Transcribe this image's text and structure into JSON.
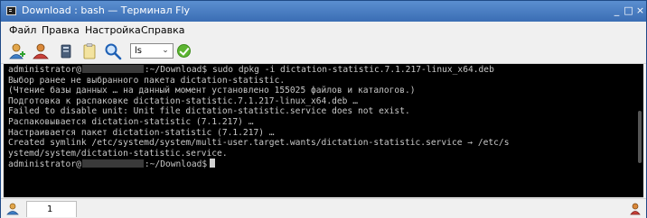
{
  "window": {
    "title": "Download : bash — Терминал Fly",
    "minimize_glyph": "_",
    "maximize_glyph": "□",
    "close_glyph": "×"
  },
  "menu": [
    "Файл",
    "Правка",
    "Настройка",
    "Справка"
  ],
  "toolbar": {
    "combo_value": "ls",
    "combo_chevron": "⌄",
    "icons": [
      "new-session-icon",
      "user-sessions-icon",
      "bookmark-icon",
      "clipboard-icon",
      "search-icon",
      "ok-check-icon"
    ],
    "ok_color": "#5cb531"
  },
  "terminal": {
    "background": "#000000",
    "foreground": "#c8c8c8",
    "lines": [
      {
        "pre": "administrator@",
        "post": ":~/Download$ sudo dpkg -i dictation-statistic.7.1.217-linux_x64.deb"
      },
      {
        "pre": "Выбор ранее не выбранного пакета dictation-statistic."
      },
      {
        "pre": "(Чтение базы данных … на данный момент установлено 155025 файлов и каталогов.)"
      },
      {
        "pre": "Подготовка к распаковке dictation-statistic.7.1.217-linux_x64.deb …"
      },
      {
        "pre": "Failed to disable unit: Unit file dictation-statistic.service does not exist."
      },
      {
        "pre": "Распаковывается dictation-statistic (7.1.217) …"
      },
      {
        "pre": "Настраивается пакет dictation-statistic (7.1.217) …"
      },
      {
        "pre": "Created symlink /etc/systemd/system/multi-user.target.wants/dictation-statistic.service → /etc/s"
      },
      {
        "pre": "ystemd/system/dictation-statistic.service."
      },
      {
        "pre": "administrator@",
        "post": ":~/Download$"
      }
    ]
  },
  "tabbar": {
    "tab_label": "1"
  }
}
